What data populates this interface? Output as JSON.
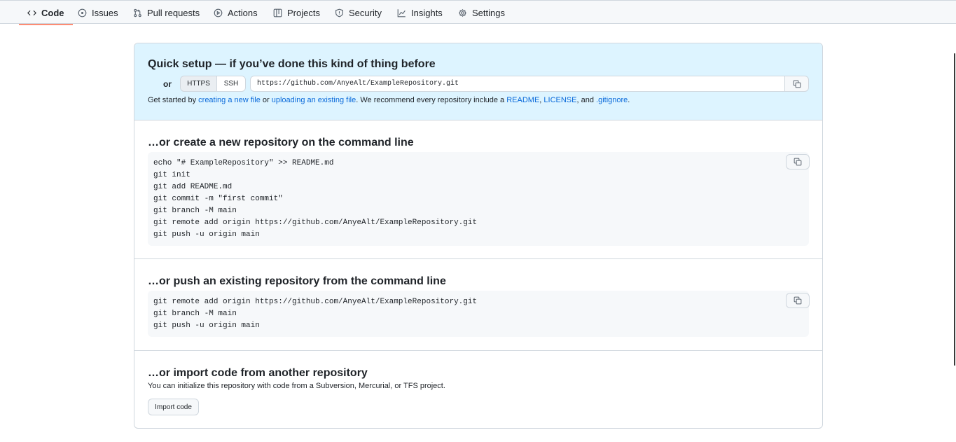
{
  "nav": {
    "tabs": [
      {
        "label": "Code",
        "icon": "code-icon",
        "active": true
      },
      {
        "label": "Issues",
        "icon": "issue-icon"
      },
      {
        "label": "Pull requests",
        "icon": "pull-request-icon"
      },
      {
        "label": "Actions",
        "icon": "play-icon"
      },
      {
        "label": "Projects",
        "icon": "table-icon"
      },
      {
        "label": "Security",
        "icon": "shield-icon"
      },
      {
        "label": "Insights",
        "icon": "graph-icon"
      },
      {
        "label": "Settings",
        "icon": "gear-icon"
      }
    ]
  },
  "quick_setup": {
    "title": "Quick setup — if you’ve done this kind of thing before",
    "or_label": "or",
    "https_label": "HTTPS",
    "ssh_label": "SSH",
    "clone_url": "https://github.com/AnyeAlt/ExampleRepository.git",
    "get_started_prefix": "Get started by ",
    "link_new_file": "creating a new file",
    "or_word": " or ",
    "link_upload": "uploading an existing file",
    "recommend_text": ". We recommend every repository include a ",
    "link_readme": "README",
    "comma": ", ",
    "link_license": "LICENSE",
    "and_word": ", and ",
    "link_gitignore": ".gitignore",
    "period": "."
  },
  "create_section": {
    "title": "…or create a new repository on the command line",
    "code": "echo \"# ExampleRepository\" >> README.md\ngit init\ngit add README.md\ngit commit -m \"first commit\"\ngit branch -M main\ngit remote add origin https://github.com/AnyeAlt/ExampleRepository.git\ngit push -u origin main"
  },
  "push_section": {
    "title": "…or push an existing repository from the command line",
    "code": "git remote add origin https://github.com/AnyeAlt/ExampleRepository.git\ngit branch -M main\ngit push -u origin main"
  },
  "import_section": {
    "title": "…or import code from another repository",
    "description": "You can initialize this repository with code from a Subversion, Mercurial, or TFS project.",
    "button_label": "Import code"
  }
}
